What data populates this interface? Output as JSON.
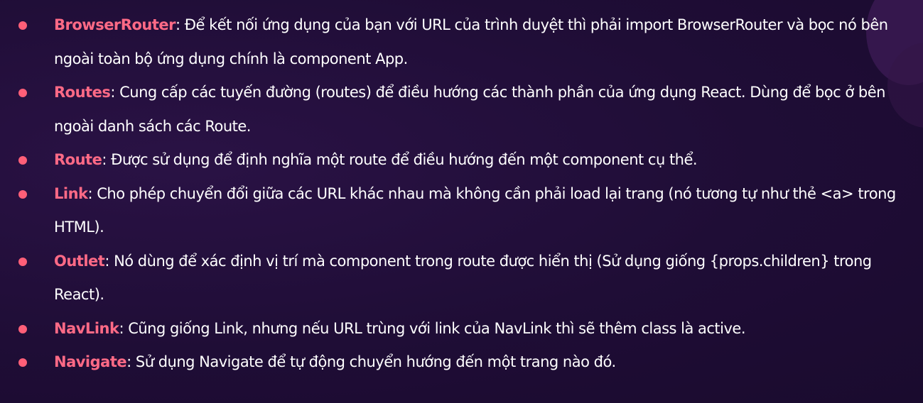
{
  "colors": {
    "background": "#1f0d36",
    "term": "#ff6a86",
    "bullet": "#ff5f78",
    "text": "#ffffff"
  },
  "items": [
    {
      "term": "BrowserRouter",
      "desc": ": Để kết nối ứng dụng của bạn với URL của trình duyệt thì phải import BrowserRouter và bọc nó bên ngoài toàn bộ ứng dụng chính là component App."
    },
    {
      "term": "Routes",
      "desc": ": Cung cấp các tuyến đường (routes) để điều hướng các thành phần của ứng dụng React. Dùng để bọc ở bên ngoài danh sách các Route."
    },
    {
      "term": "Route",
      "desc": ": Được sử dụng để định nghĩa một route để điều hướng đến một component cụ thể."
    },
    {
      "term": "Link",
      "desc": ": Cho phép chuyển đổi giữa các URL khác nhau mà không cần phải load lại trang (nó tương tự như thẻ <a> trong HTML)."
    },
    {
      "term": "Outlet",
      "desc": ": Nó dùng để xác định vị trí mà component trong route được hiển thị (Sử dụng giống {props.children} trong React)."
    },
    {
      "term": "NavLink",
      "desc": ": Cũng giống Link, nhưng nếu URL trùng với link của NavLink thì sẽ thêm class là active."
    },
    {
      "term": "Navigate",
      "desc": ": Sử dụng Navigate để tự động chuyển hướng đến một trang nào đó."
    }
  ]
}
